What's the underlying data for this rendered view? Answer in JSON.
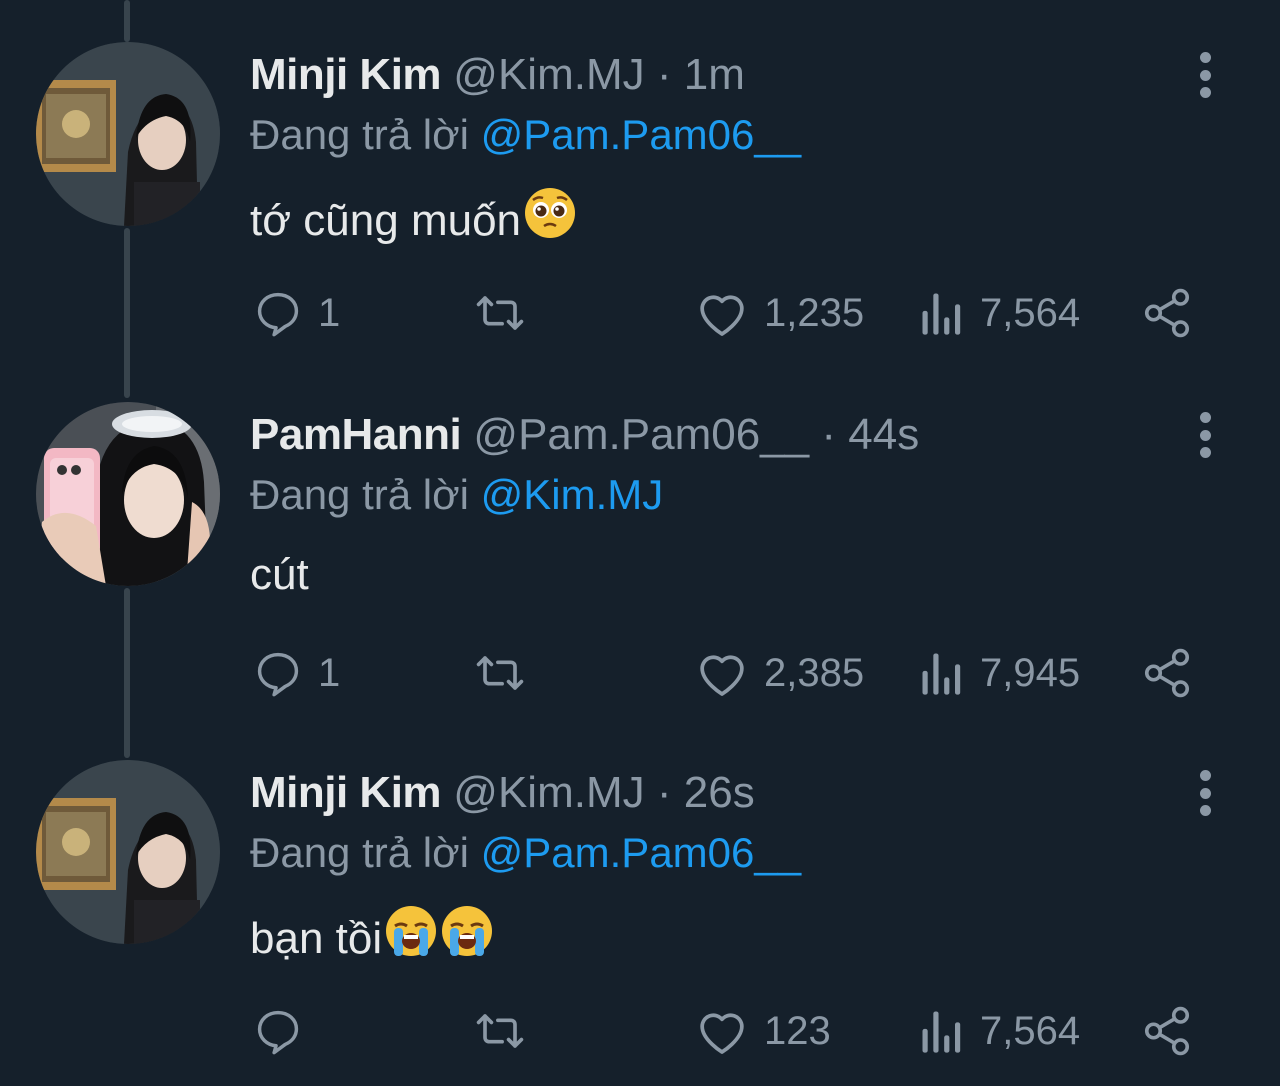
{
  "colors": {
    "background": "#15202b",
    "text_primary": "#e7e9ea",
    "text_secondary": "#8b98a5",
    "mention": "#1d9bf0",
    "thread_line": "#38444d"
  },
  "tweets": [
    {
      "name": "Minji Kim",
      "handle": "@Kim.MJ",
      "separator": "·",
      "time": "1m",
      "replying_prefix": "Đang trả lời ",
      "replying_to": "@Pam.Pam06__",
      "text": "tớ cũng muốn",
      "emojis": [
        "pleading-face-emoji"
      ],
      "actions": {
        "replies": "1",
        "retweets": "",
        "likes": "1,235",
        "views": "7,564"
      },
      "avatar": "avatar-photo-girl-with-painting"
    },
    {
      "name": "PamHanni",
      "handle": "@Pam.Pam06__",
      "separator": "·",
      "time": "44s",
      "replying_prefix": "Đang trả lời ",
      "replying_to": "@Kim.MJ",
      "text": "cút",
      "emojis": [],
      "actions": {
        "replies": "1",
        "retweets": "",
        "likes": "2,385",
        "views": "7,945"
      },
      "avatar": "avatar-photo-girl-mirror-selfie"
    },
    {
      "name": "Minji Kim",
      "handle": "@Kim.MJ",
      "separator": "·",
      "time": "26s",
      "replying_prefix": "Đang trả lời ",
      "replying_to": "@Pam.Pam06__",
      "text": "bạn tồi",
      "emojis": [
        "loudly-crying-face-emoji",
        "loudly-crying-face-emoji"
      ],
      "actions": {
        "replies": "",
        "retweets": "",
        "likes": "123",
        "views": "7,564"
      },
      "avatar": "avatar-photo-girl-with-painting"
    }
  ]
}
